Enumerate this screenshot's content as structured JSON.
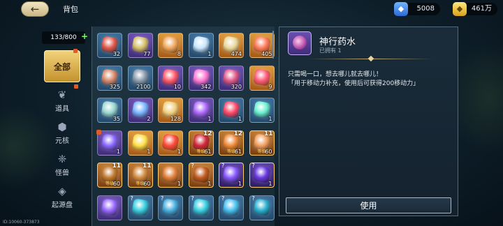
{
  "header": {
    "title": "背包"
  },
  "resources": [
    {
      "icon": "blue-gem-icon",
      "value": "5008"
    },
    {
      "icon": "gold-coin-icon",
      "value": "461万"
    }
  ],
  "capacity": {
    "text": "133/800"
  },
  "tabs": [
    {
      "label": "全部",
      "icon": ""
    },
    {
      "label": "道具",
      "icon": "potion-icon"
    },
    {
      "label": "元核",
      "icon": "core-icon"
    },
    {
      "label": "怪兽",
      "icon": "monster-icon"
    },
    {
      "label": "起源盘",
      "icon": "disk-icon"
    }
  ],
  "items": [
    {
      "count": "32",
      "rarity": "blue",
      "color": "#e0584a"
    },
    {
      "count": "77",
      "rarity": "purple",
      "color": "#d6c06a"
    },
    {
      "count": "8",
      "rarity": "gold",
      "color": "#f0a860"
    },
    {
      "count": "1",
      "rarity": "blue",
      "color": "#c8e6ff"
    },
    {
      "count": "474",
      "rarity": "gold",
      "color": "#e8d79a"
    },
    {
      "count": "405",
      "rarity": "gold",
      "color": "#ff7a5a"
    },
    {
      "count": "325",
      "rarity": "blue",
      "color": "#d6886a"
    },
    {
      "count": "2100",
      "rarity": "blue",
      "color": "#8a9aac"
    },
    {
      "count": "10",
      "rarity": "purple",
      "color": "#ff5a6a"
    },
    {
      "count": "342",
      "rarity": "purple",
      "color": "#ff7ad6"
    },
    {
      "count": "320",
      "rarity": "purple",
      "color": "#e05a8a"
    },
    {
      "count": "9",
      "rarity": "gold",
      "color": "#ff5a7a"
    },
    {
      "count": "35",
      "rarity": "blue",
      "color": "#9ad6d0"
    },
    {
      "count": "2",
      "rarity": "purple",
      "color": "#7ab6ff"
    },
    {
      "count": "128",
      "rarity": "gold",
      "color": "#f0d080"
    },
    {
      "count": "1",
      "rarity": "purple",
      "color": "#b06aff"
    },
    {
      "count": "1",
      "rarity": "blue",
      "color": "#ff4a6a"
    },
    {
      "count": "1",
      "rarity": "blue",
      "color": "#6af0d0"
    },
    {
      "count": "1",
      "rarity": "purple",
      "color": "#8a6aff",
      "mark": true
    },
    {
      "count": "1",
      "rarity": "gold",
      "color": "#ffe04a"
    },
    {
      "count": "1",
      "rarity": "gold",
      "color": "#ff4a3a"
    },
    {
      "count": "61",
      "rarity": "gold-b",
      "color": "#d0283a",
      "badge": "12",
      "tag": "等级"
    },
    {
      "count": "61",
      "rarity": "gold-b",
      "color": "#f08a3a",
      "badge": "12",
      "tag": "等级"
    },
    {
      "count": "60",
      "rarity": "gold-b",
      "color": "#f0a060",
      "badge": "11",
      "tag": "等级"
    },
    {
      "count": "60",
      "rarity": "gold-b",
      "color": "#c07a30",
      "badge": "11",
      "tag": "等级"
    },
    {
      "count": "60",
      "rarity": "gold-b",
      "color": "#d08a40",
      "badge": "11",
      "tag": "等级"
    },
    {
      "count": "1",
      "rarity": "gold-b",
      "color": "#e0803a"
    },
    {
      "count": "1",
      "rarity": "gold-b",
      "color": "#c05a20",
      "q": "?"
    },
    {
      "count": "1",
      "rarity": "purple-b",
      "color": "#8a5aff",
      "q": "?"
    },
    {
      "count": "1",
      "rarity": "purple-b",
      "color": "#6a3ae0",
      "q": "?"
    },
    {
      "count": "",
      "rarity": "purple",
      "color": "#9a6aff"
    },
    {
      "count": "",
      "rarity": "blue",
      "color": "#3ad0e0",
      "q": "?"
    },
    {
      "count": "",
      "rarity": "blue",
      "color": "#4ab0e0",
      "q": "?"
    },
    {
      "count": "",
      "rarity": "blue",
      "color": "#3ad0e0",
      "q": "?"
    },
    {
      "count": "",
      "rarity": "blue",
      "color": "#4ac0f0",
      "q": "?"
    },
    {
      "count": "",
      "rarity": "blue",
      "color": "#2ab0d0",
      "q": "?"
    }
  ],
  "detail": {
    "name": "神行药水",
    "owned": "已拥有 1",
    "desc1": "只需喝一口，想去哪儿就去哪儿！",
    "desc2": "「用于移动力补充，使用后可获得200移动力」",
    "use_label": "使用"
  },
  "footer": {
    "id_text": "ID:10060-373873"
  }
}
